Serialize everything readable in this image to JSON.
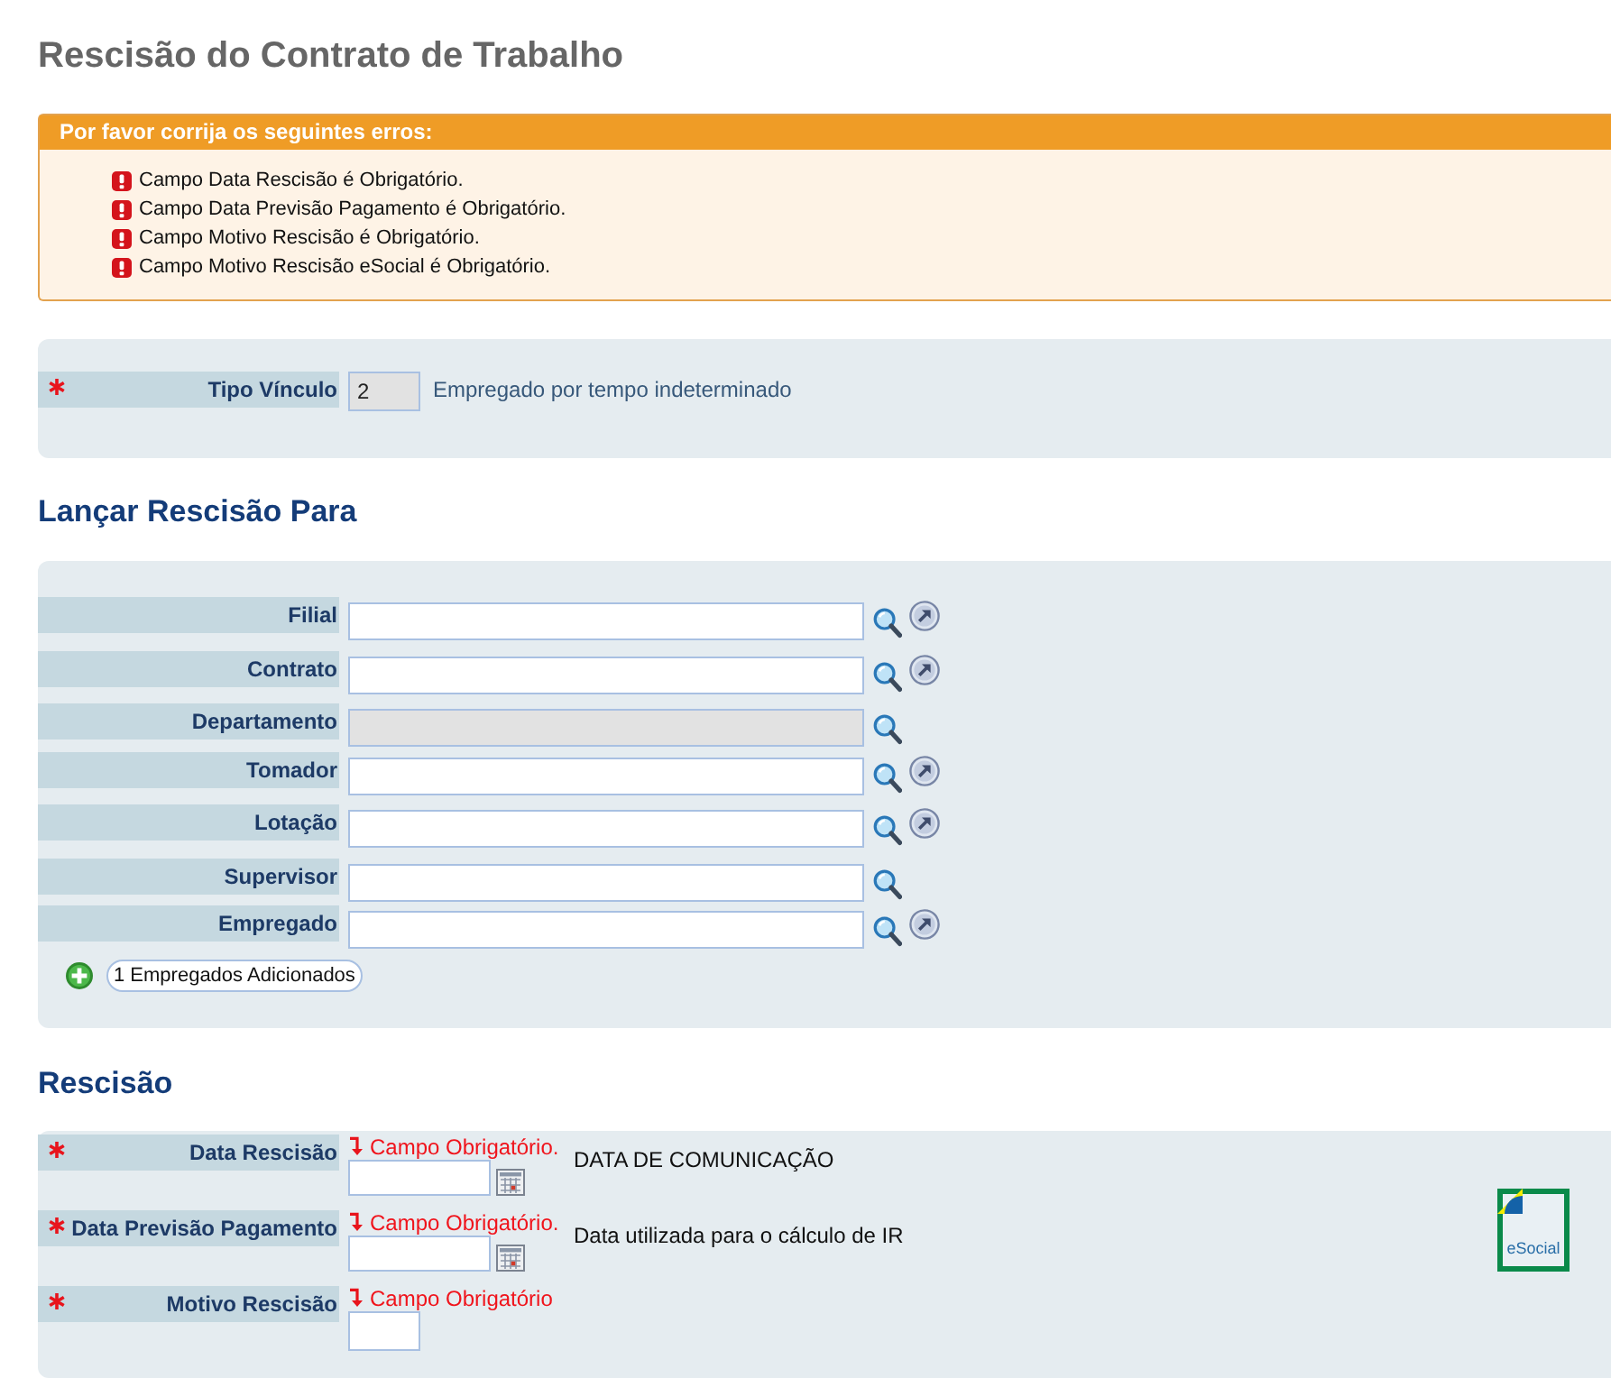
{
  "page": {
    "title": "Rescisão do Contrato de Trabalho"
  },
  "error_box": {
    "title": "Por favor corrija os seguintes erros:",
    "items": [
      "Campo Data Rescisão é Obrigatório.",
      "Campo Data Previsão Pagamento é Obrigatório.",
      "Campo Motivo Rescisão é Obrigatório.",
      "Campo Motivo Rescisão eSocial é Obrigatório."
    ]
  },
  "vinculo": {
    "label": "Tipo Vínculo",
    "required": true,
    "value": "2",
    "disabled": true,
    "description": "Empregado por tempo indeterminado"
  },
  "lancar_rescisao_para": {
    "heading": "Lançar Rescisão Para",
    "fields": [
      {
        "label": "Filial",
        "disabled": false,
        "link_button": true
      },
      {
        "label": "Contrato",
        "disabled": false,
        "link_button": true
      },
      {
        "label": "Departamento",
        "disabled": true,
        "link_button": false
      },
      {
        "label": "Tomador",
        "disabled": false,
        "link_button": true
      },
      {
        "label": "Lotação",
        "disabled": false,
        "link_button": true
      },
      {
        "label": "Supervisor",
        "disabled": false,
        "link_button": false
      },
      {
        "label": "Empregado",
        "disabled": false,
        "link_button": true
      }
    ],
    "added_button": "1 Empregados Adicionados"
  },
  "rescisao": {
    "heading": "Rescisão",
    "fields": [
      {
        "kind": "date",
        "label": "Data Rescisão",
        "required": true,
        "error": "Campo Obrigatório.",
        "description": "DATA DE COMUNICAÇÃO"
      },
      {
        "kind": "date",
        "label": "Data Previsão Pagamento",
        "required": true,
        "error": "Campo Obrigatório.",
        "description": "Data utilizada para o cálculo de IR"
      },
      {
        "kind": "code",
        "label": "Motivo Rescisão",
        "required": true,
        "error": "Campo Obrigatório"
      }
    ],
    "logo": {
      "text": "eSocial"
    }
  }
}
